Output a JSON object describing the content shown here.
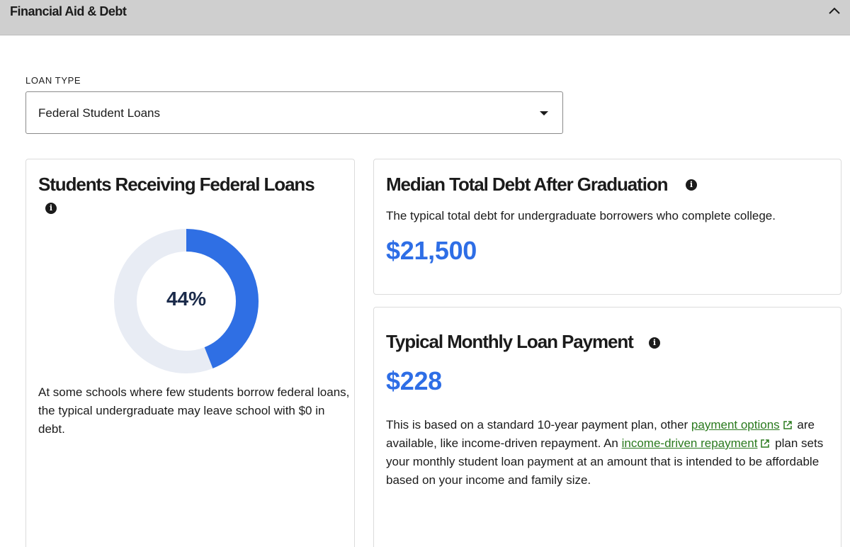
{
  "header": {
    "title": "Financial Aid & Debt"
  },
  "loan_type": {
    "label": "LOAN TYPE",
    "selected": "Federal Student Loans"
  },
  "federal_loans": {
    "title": "Students Receiving Federal Loans",
    "percent_value": 44,
    "percent_label": "44%",
    "note": "At some schools where few students borrow federal loans, the typical undergraduate may leave school with $0 in debt.",
    "colors": {
      "fill": "#2f6fe4",
      "track": "#e8ecf4"
    }
  },
  "median_debt": {
    "title": "Median Total Debt After Graduation",
    "description": "The typical total debt for undergraduate borrowers who complete college.",
    "amount": "$21,500"
  },
  "monthly_payment": {
    "title": "Typical Monthly Loan Payment",
    "amount": "$228",
    "text1": "This is based on a standard 10-year payment plan, other ",
    "link1": "payment options",
    "text2": " are available, like income-driven repayment. An ",
    "link2": "income-driven repayment",
    "text3": " plan sets your monthly student loan payment at an amount that is intended to be affordable based on your income and family size."
  },
  "icons": [
    "chevron-up-icon",
    "caret-down-icon",
    "info-icon",
    "external-link-icon"
  ],
  "colors": {
    "accent": "#2e6ee6",
    "link": "#2a7a1e",
    "header_bg": "#cfcfcf"
  }
}
